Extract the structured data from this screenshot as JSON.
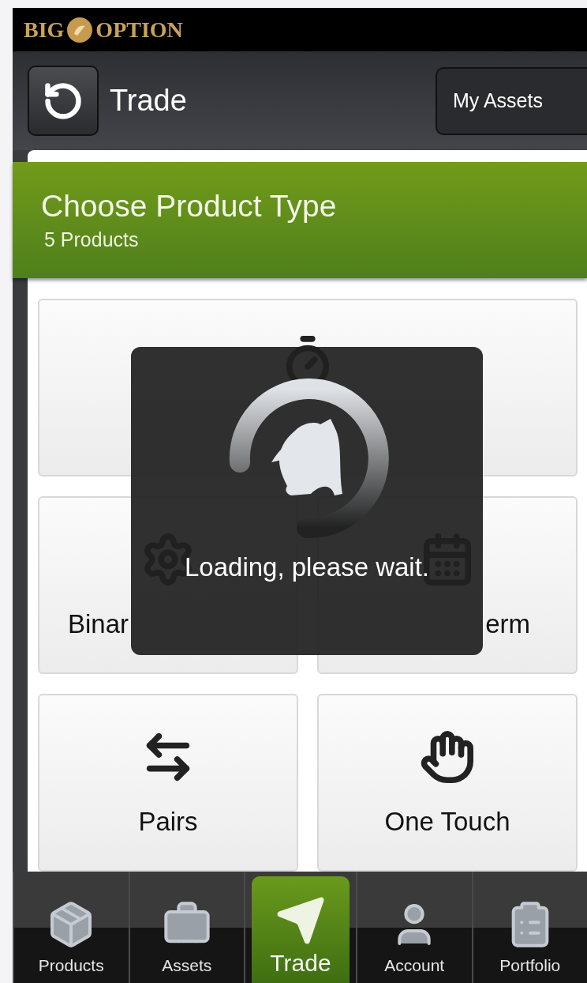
{
  "brand": {
    "left": "BIG",
    "right": "OPTION"
  },
  "header": {
    "title": "Trade",
    "button": "My Assets"
  },
  "banner": {
    "title": "Choose Product Type",
    "subtitle": "5 Products"
  },
  "products": [
    {
      "kind": "stopwatch",
      "wide": true
    },
    {
      "label": "Binar",
      "kind": "gear",
      "wide": false
    },
    {
      "label": "erm",
      "kind": "calendar",
      "wide": false
    },
    {
      "label": "Pairs",
      "kind": "arrows",
      "wide": false
    },
    {
      "label": "One Touch",
      "kind": "hand",
      "wide": false
    }
  ],
  "overlay": {
    "message": "Loading, please wait."
  },
  "tabs": [
    {
      "label": "Products",
      "kind": "box",
      "selected": false
    },
    {
      "label": "Assets",
      "kind": "briefcase",
      "selected": false
    },
    {
      "label": "Trade",
      "kind": "plane",
      "selected": true
    },
    {
      "label": "Account",
      "kind": "user",
      "selected": false
    },
    {
      "label": "Portfolio",
      "kind": "clipboard",
      "selected": false
    }
  ]
}
